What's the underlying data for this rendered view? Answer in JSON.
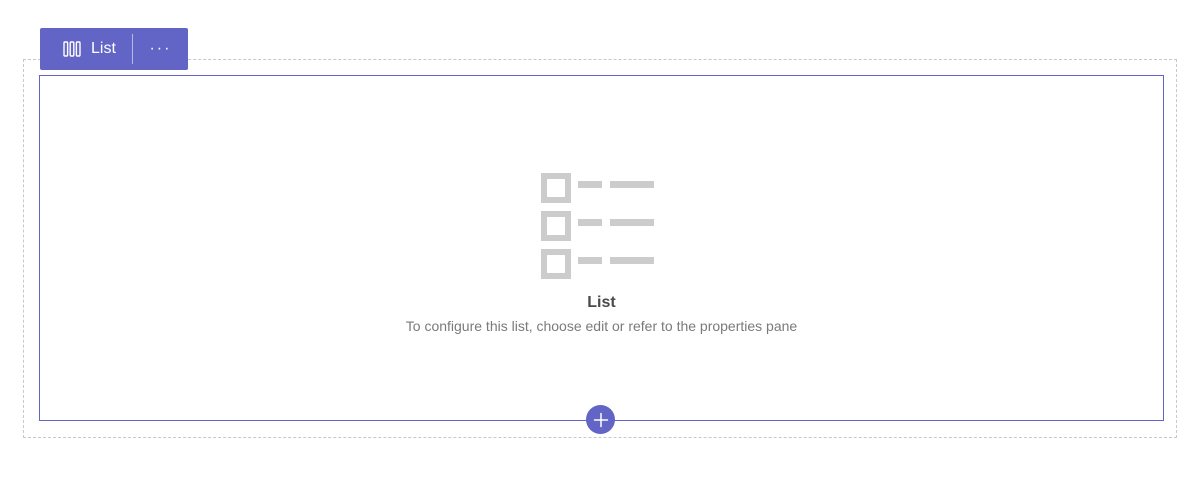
{
  "toolbar": {
    "webpart_label": "List",
    "webpart_icon": "columns-icon",
    "more_label": "···",
    "more_icon": "more-icon"
  },
  "placeholder": {
    "icon": "bulleted-list-icon",
    "title": "List",
    "description": "To configure this list, choose edit or refer to the properties pane"
  },
  "add_section": {
    "icon": "plus-icon"
  },
  "colors": {
    "accent": "#6264c6",
    "placeholder_icon": "#cccccc",
    "title_text": "#4a4a4a",
    "description_text": "#7a7a7a",
    "section_outline": "#c8c8c8"
  }
}
